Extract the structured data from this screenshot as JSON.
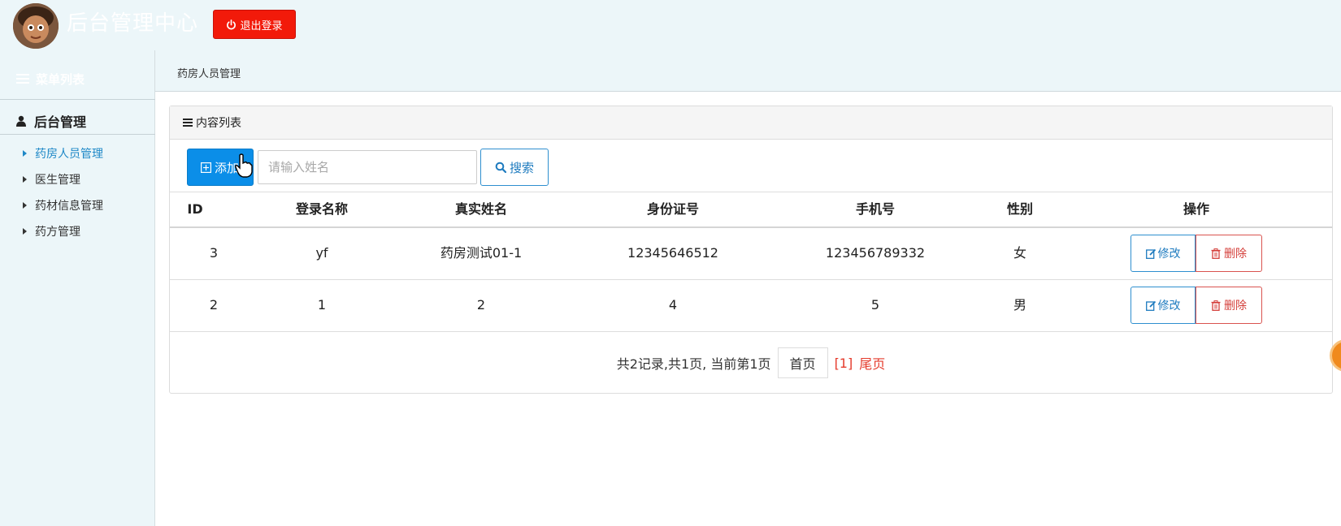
{
  "header": {
    "title": "后台管理中心",
    "logout_label": "退出登录"
  },
  "sidebar": {
    "menu_header": "菜单列表",
    "group_title": "后台管理",
    "items": [
      {
        "label": "药房人员管理"
      },
      {
        "label": "医生管理"
      },
      {
        "label": "药材信息管理"
      },
      {
        "label": "药方管理"
      }
    ]
  },
  "breadcrumb": "药房人员管理",
  "panel": {
    "title": "内容列表",
    "add_label": "添加",
    "search_placeholder": "请输入姓名",
    "search_label": "搜索"
  },
  "table": {
    "columns": [
      "ID",
      "登录名称",
      "真实姓名",
      "身份证号",
      "手机号",
      "性别",
      "操作"
    ],
    "rows": [
      {
        "id": "3",
        "login": "yf",
        "name": "药房测试01-1",
        "idcard": "12345646512",
        "phone": "123456789332",
        "gender": "女"
      },
      {
        "id": "2",
        "login": "1",
        "name": "2",
        "idcard": "4",
        "phone": "5",
        "gender": "男"
      }
    ],
    "edit_label": "修改",
    "delete_label": "删除"
  },
  "pager": {
    "summary": "共2记录,共1页, 当前第1页",
    "first_label": "首页",
    "current": "[1]",
    "last_label": "尾页"
  },
  "colors": {
    "accent": "#0b8ee8",
    "danger": "#f21a0a",
    "active_link": "#1e88c7"
  },
  "icons": {
    "logout": "power-icon",
    "menu": "list-icon",
    "group": "user-icon",
    "add": "plus-square-icon",
    "search": "search-icon",
    "edit": "edit-icon",
    "delete": "trash-icon"
  }
}
